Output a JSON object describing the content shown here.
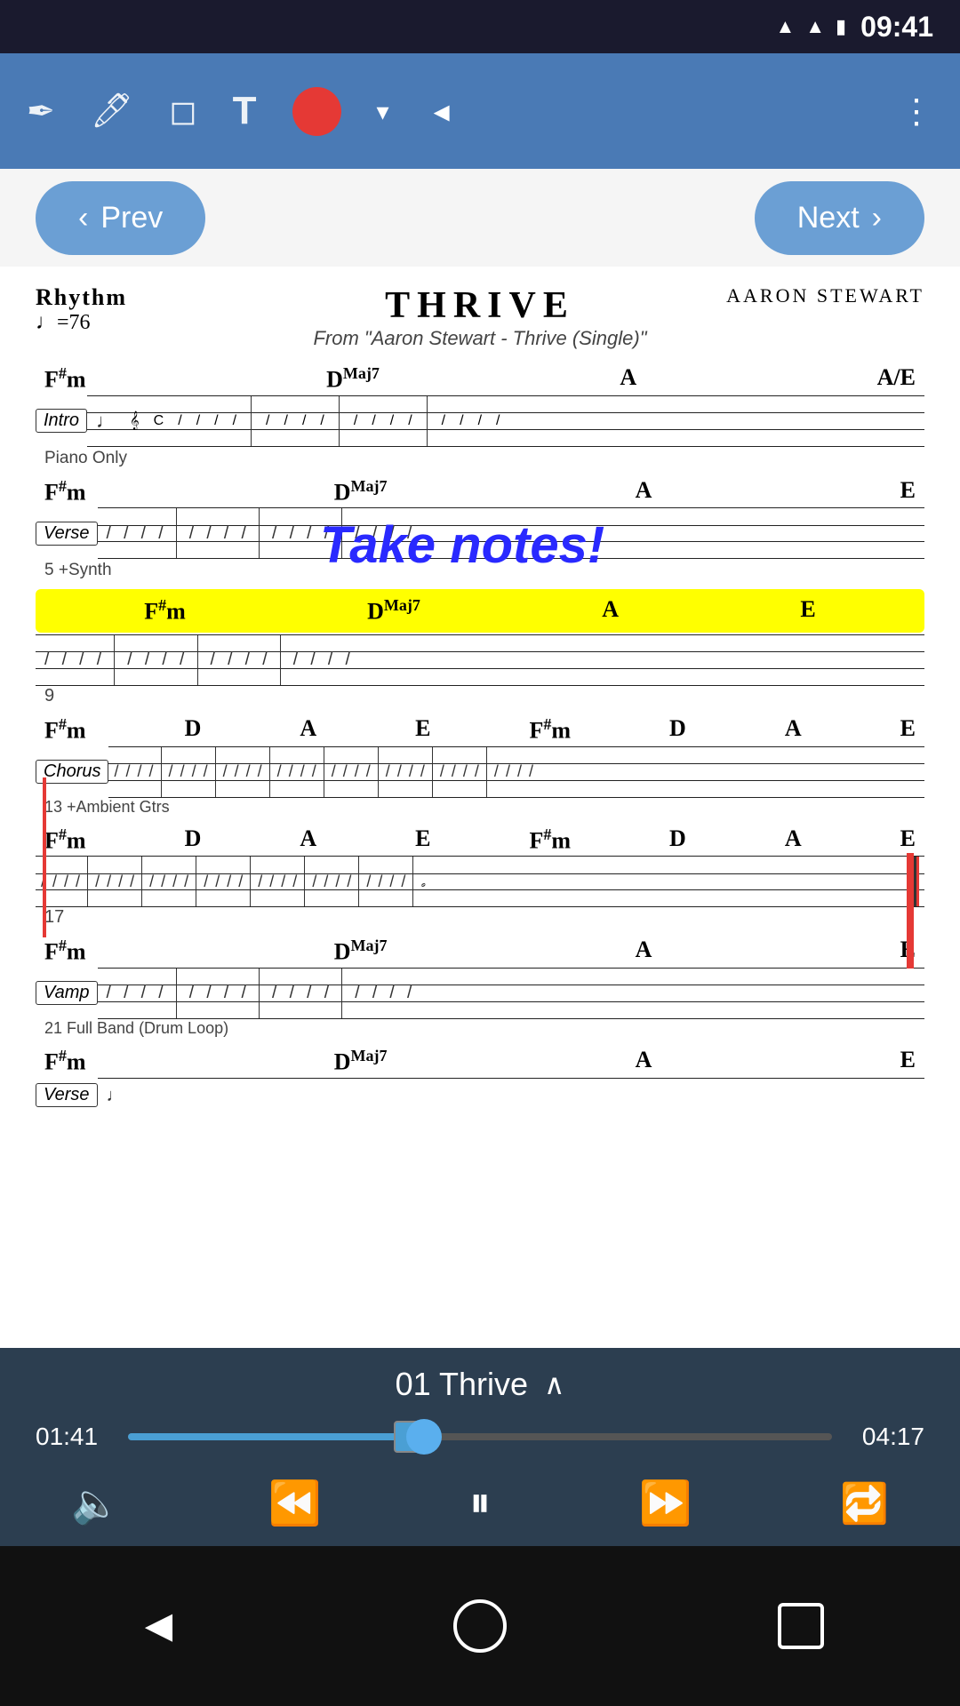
{
  "statusBar": {
    "time": "09:41",
    "icons": [
      "wifi",
      "signal",
      "battery"
    ]
  },
  "toolbar": {
    "items": [
      {
        "name": "pen-tool",
        "symbol": "✒"
      },
      {
        "name": "highlighter-tool",
        "symbol": "🖊"
      },
      {
        "name": "eraser-tool",
        "symbol": "◻"
      },
      {
        "name": "text-tool",
        "symbol": "T"
      },
      {
        "name": "record-btn",
        "symbol": "●"
      },
      {
        "name": "dropdown",
        "symbol": "▾"
      },
      {
        "name": "volume-tool",
        "symbol": "◂"
      },
      {
        "name": "more-options",
        "symbol": "⋮"
      }
    ]
  },
  "navigation": {
    "prev_label": "Prev",
    "next_label": "Next"
  },
  "sheet": {
    "title": "THRIVE",
    "subtitle": "From \"Aaron Stewart - Thrive (Single)\"",
    "composer": "Aaron Stewart",
    "rhythm_label": "Rhythm",
    "tempo": "♩=76",
    "annotation": "Take notes!",
    "sections": [
      {
        "label": "Intro",
        "note_label": "Piano Only",
        "number": "",
        "chords": [
          "F♯m",
          "DMaj7",
          "A",
          "A/E"
        ]
      },
      {
        "label": "Verse",
        "note_label": "5 +Synth",
        "number": "5",
        "chords": [
          "F♯m",
          "DMaj7",
          "A",
          "E"
        ]
      },
      {
        "label": "",
        "note_label": "",
        "number": "9",
        "chords": [
          "F♯m",
          "DMaj7",
          "A",
          "E"
        ],
        "highlight": true
      },
      {
        "label": "Chorus",
        "note_label": "13 +Ambient Gtrs",
        "number": "13",
        "chords": [
          "F♯m",
          "D",
          "A",
          "E",
          "F♯m",
          "D",
          "A",
          "E"
        ]
      },
      {
        "label": "",
        "note_label": "",
        "number": "17",
        "chords": [
          "F♯m",
          "D",
          "A",
          "E",
          "F♯m",
          "D",
          "A",
          "E"
        ]
      },
      {
        "label": "Vamp",
        "note_label": "21 Full Band (Drum Loop)",
        "number": "21",
        "chords": [
          "F♯m",
          "DMaj7",
          "A",
          "E"
        ]
      },
      {
        "label": "Verse",
        "note_label": "",
        "number": "",
        "chords": [
          "F♯m",
          "DMaj7",
          "A",
          "E"
        ]
      }
    ]
  },
  "player": {
    "track_name": "01 Thrive",
    "current_time": "01:41",
    "total_time": "04:17",
    "progress_percent": 40,
    "controls": {
      "volume_icon": "🔈",
      "rewind_icon": "⏪",
      "pause_icon": "⏸",
      "fast_forward_icon": "⏩",
      "repeat_icon": "🔁"
    }
  },
  "bottomNav": {
    "back_icon": "◄",
    "home_icon": "○",
    "square_icon": "□"
  }
}
